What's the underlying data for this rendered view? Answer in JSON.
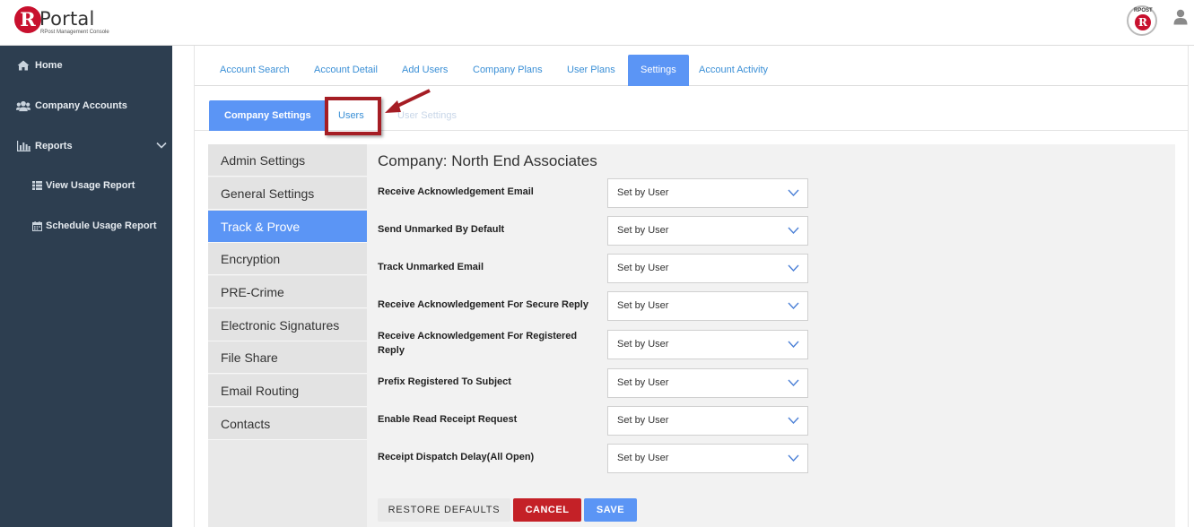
{
  "header": {
    "logo_letter": "R",
    "logo_text": "Portal",
    "logo_subtitle": "RPost Management Console",
    "brand_badge_text": "RPOST",
    "brand_badge_letter": "R"
  },
  "sidebar": {
    "items": [
      {
        "label": "Home",
        "icon": "home-icon"
      },
      {
        "label": "Company Accounts",
        "icon": "users-icon"
      },
      {
        "label": "Reports",
        "icon": "bar-chart-icon"
      },
      {
        "label": "View Usage Report",
        "icon": "list-icon"
      },
      {
        "label": "Schedule Usage Report",
        "icon": "calendar-icon"
      }
    ]
  },
  "tabs": [
    {
      "label": "Account Search"
    },
    {
      "label": "Account Detail"
    },
    {
      "label": "Add Users"
    },
    {
      "label": "Company Plans"
    },
    {
      "label": "User Plans"
    },
    {
      "label": "Settings",
      "active": true
    },
    {
      "label": "Account Activity"
    }
  ],
  "subtabs": [
    {
      "label": "Company Settings",
      "active": true
    },
    {
      "label": "Users"
    },
    {
      "label": "User Settings"
    }
  ],
  "settings_menu": [
    {
      "label": "Admin Settings"
    },
    {
      "label": "General Settings"
    },
    {
      "label": "Track & Prove",
      "active": true
    },
    {
      "label": "Encryption"
    },
    {
      "label": "PRE-Crime"
    },
    {
      "label": "Electronic Signatures"
    },
    {
      "label": "File Share"
    },
    {
      "label": "Email Routing"
    },
    {
      "label": "Contacts"
    }
  ],
  "content": {
    "company_title": "Company: North End Associates",
    "settings": [
      {
        "label": "Receive Acknowledgement Email",
        "value": "Set by User"
      },
      {
        "label": "Send Unmarked By Default",
        "value": "Set by User"
      },
      {
        "label": "Track Unmarked Email",
        "value": "Set by User"
      },
      {
        "label": "Receive Acknowledgement For Secure Reply",
        "value": "Set by User"
      },
      {
        "label": "Receive Acknowledgement For Registered Reply",
        "value": "Set by User"
      },
      {
        "label": "Prefix Registered To Subject",
        "value": "Set by User"
      },
      {
        "label": "Enable Read Receipt Request",
        "value": "Set by User"
      },
      {
        "label": "Receipt Dispatch Delay(All Open)",
        "value": "Set by User"
      }
    ],
    "buttons": {
      "restore": "RESTORE DEFAULTS",
      "cancel": "CANCEL",
      "save": "SAVE"
    }
  },
  "colors": {
    "sidebar_bg": "#2d3e50",
    "accent": "#5b95f5",
    "link": "#3a8fd6",
    "danger": "#c42127",
    "highlight": "#a51d24"
  }
}
